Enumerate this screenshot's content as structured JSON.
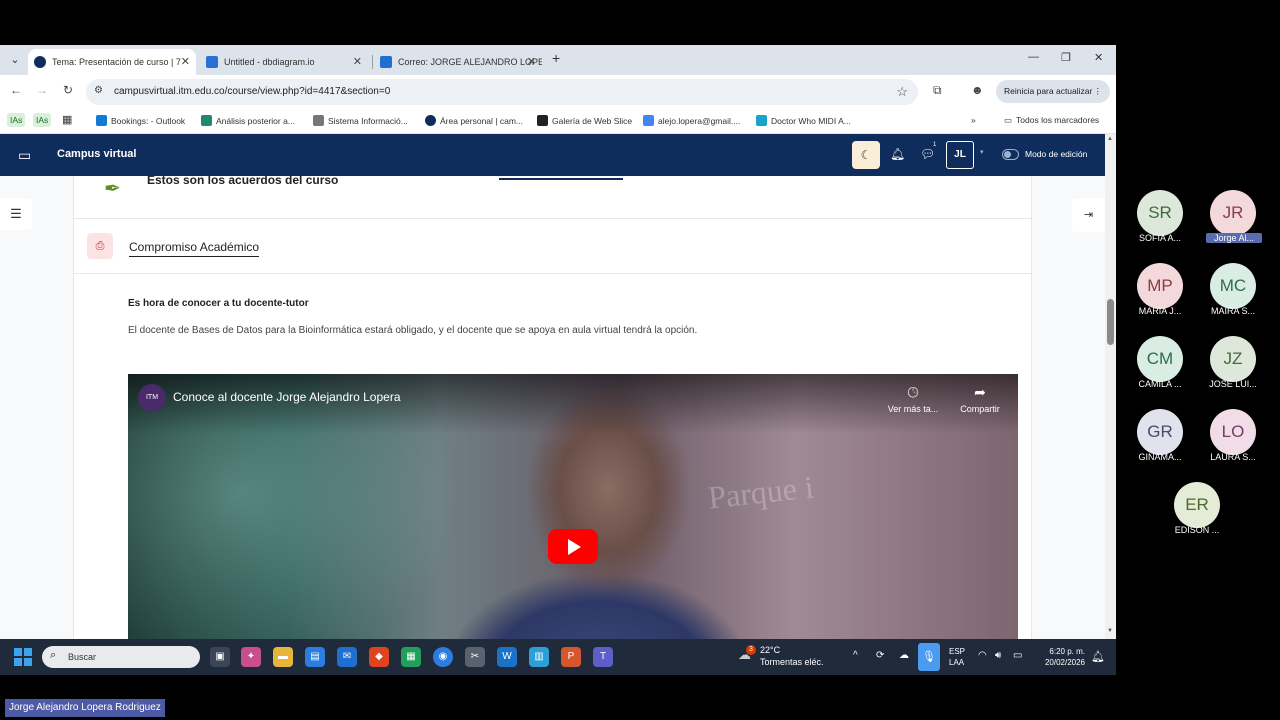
{
  "browser": {
    "tabs": [
      {
        "label": "Tema: Presentación de curso | 7",
        "active": true
      },
      {
        "label": "Untitled - dbdiagram.io",
        "active": false
      },
      {
        "label": "Correo: JORGE ALEJANDRO LOPE",
        "active": false
      }
    ],
    "url": "campusvirtual.itm.edu.co/course/view.php?id=4417&section=0",
    "update_button": "Reinicia para actualizar",
    "bookmarks": [
      "Bookings: - Outlook",
      "Análisis posterior a...",
      "Sistema Informació...",
      "Área personal | cam...",
      "Galería de Web Slice",
      "alejo.lopera@gmail....",
      "Doctor Who MIDI A..."
    ],
    "ias_label": "IAs",
    "all_bookmarks": "Todos los marcadores"
  },
  "moodle": {
    "brand": "Campus virtual",
    "user_initials": "JL",
    "message_badge": "1",
    "edit_mode_label": "Modo de edición"
  },
  "content": {
    "prev_item_text": "Estos son los acuerdos del curso",
    "activity_title": "Compromiso Académico",
    "section_heading": "Es hora de conocer a tu docente-tutor",
    "section_body": "El docente de Bases de Datos para la Bioinformática estará obligado, y el docente que se apoya en aula virtual tendrá la opción.",
    "video": {
      "title": "Conoce al docente Jorge Alejandro Lopera",
      "watch_later": "Ver más ta...",
      "share": "Compartir",
      "sign_text": "Parque i"
    }
  },
  "taskbar": {
    "search_label": "Buscar",
    "weather_temp": "22°C",
    "weather_desc": "Tormentas eléc.",
    "weather_badge": "3",
    "lang_line1": "ESP",
    "lang_line2": "LAA",
    "time": "6:20 p. m.",
    "date": "20/02/2026"
  },
  "participants": [
    {
      "initials": "SR",
      "name": "SOFIA A...",
      "color": "#dde8da",
      "text": "#3f6b3a"
    },
    {
      "initials": "JR",
      "name": "Jorge Al...",
      "color": "#f4d9dc",
      "text": "#8a3b45",
      "highlight": true
    },
    {
      "initials": "MP",
      "name": "MARIA J...",
      "color": "#f4d9dc",
      "text": "#8a3b45"
    },
    {
      "initials": "MC",
      "name": "MAIRA S...",
      "color": "#d9ede4",
      "text": "#2f6b55"
    },
    {
      "initials": "CM",
      "name": "CAMILA ...",
      "color": "#d9ede4",
      "text": "#2f6b55"
    },
    {
      "initials": "JZ",
      "name": "JOSE LUI...",
      "color": "#dde8da",
      "text": "#3f6b3a"
    },
    {
      "initials": "GR",
      "name": "GINAMA...",
      "color": "#e2e2ee",
      "text": "#4a4a6a"
    },
    {
      "initials": "LO",
      "name": "LAURA S...",
      "color": "#f0dde8",
      "text": "#7a3b62"
    },
    {
      "initials": "ER",
      "name": "EDISON ...",
      "color": "#e4ecd8",
      "text": "#4c6b2f"
    }
  ],
  "speaker_label": "Jorge Alejandro Lopera Rodriguez"
}
